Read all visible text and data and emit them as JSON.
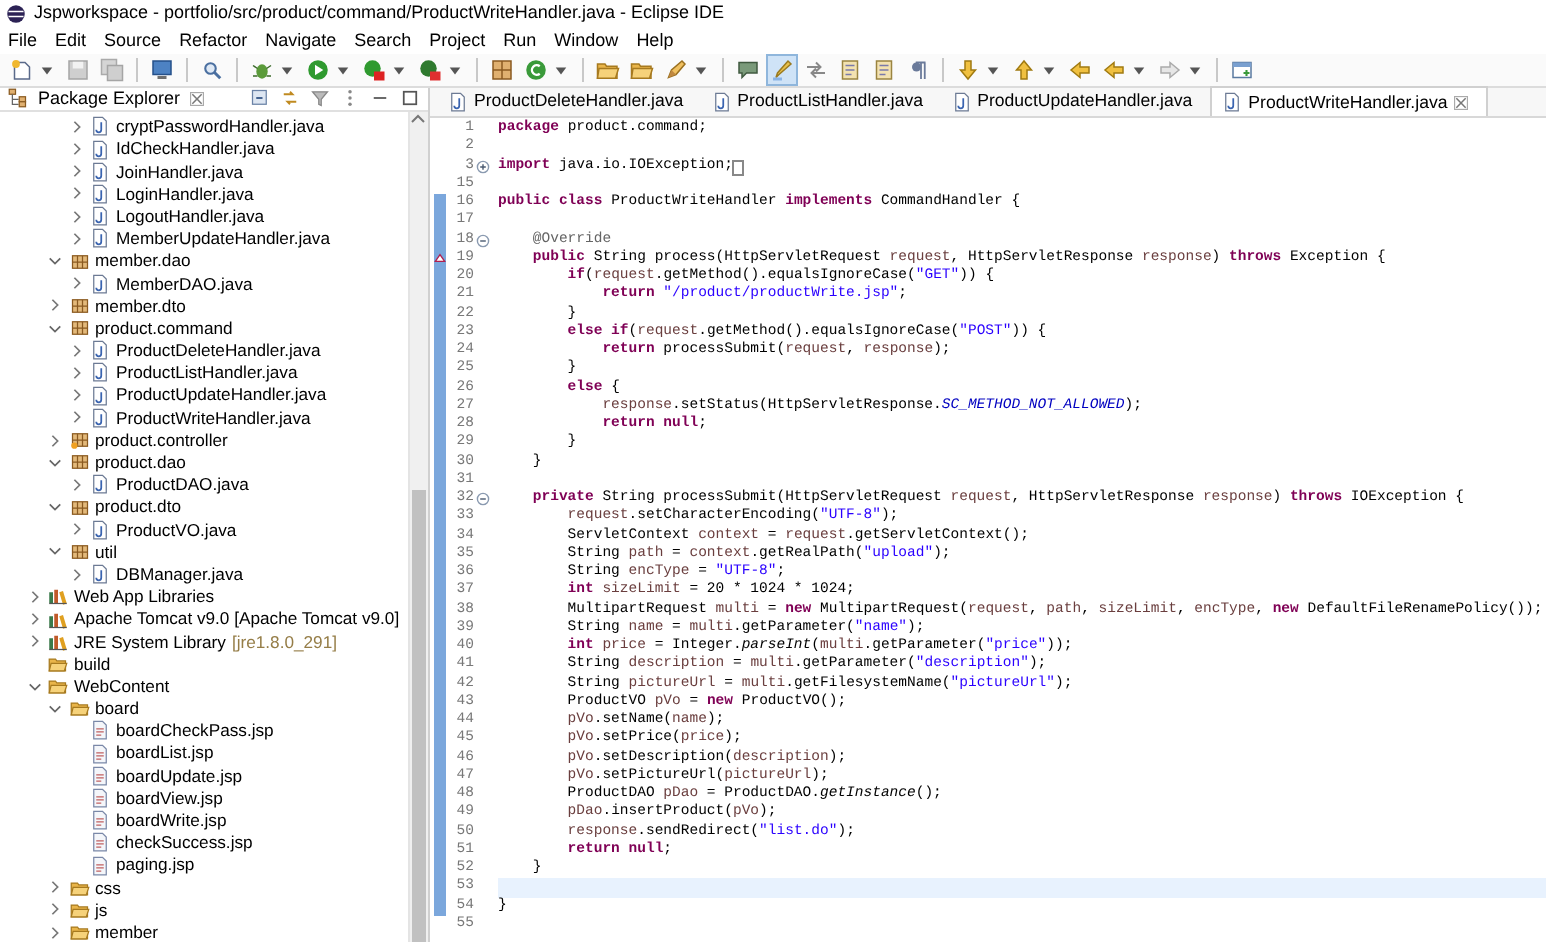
{
  "window": {
    "title": "Jspworkspace - portfolio/src/product/command/ProductWriteHandler.java - Eclipse IDE"
  },
  "menu": [
    "File",
    "Edit",
    "Source",
    "Refactor",
    "Navigate",
    "Search",
    "Project",
    "Run",
    "Window",
    "Help"
  ],
  "toolbar": [
    {
      "kind": "new",
      "dropdown": true,
      "pressed": false
    },
    {
      "kind": "save",
      "dropdown": false,
      "pressed": false
    },
    {
      "kind": "save-all",
      "dropdown": false,
      "pressed": false
    },
    {
      "kind": "separator"
    },
    {
      "kind": "monitor",
      "dropdown": false,
      "pressed": false
    },
    {
      "kind": "separator"
    },
    {
      "kind": "search",
      "dropdown": false,
      "pressed": false
    },
    {
      "kind": "separator"
    },
    {
      "kind": "debug",
      "dropdown": true,
      "pressed": false
    },
    {
      "kind": "run",
      "dropdown": true,
      "pressed": false
    },
    {
      "kind": "coverage",
      "dropdown": true,
      "pressed": false
    },
    {
      "kind": "external",
      "dropdown": true,
      "pressed": false
    },
    {
      "kind": "separator"
    },
    {
      "kind": "package",
      "dropdown": false,
      "pressed": false
    },
    {
      "kind": "class",
      "dropdown": true,
      "pressed": false
    },
    {
      "kind": "separator"
    },
    {
      "kind": "folder",
      "dropdown": false,
      "pressed": false
    },
    {
      "kind": "folder",
      "dropdown": false,
      "pressed": false
    },
    {
      "kind": "pencil",
      "dropdown": true,
      "pressed": false
    },
    {
      "kind": "separator"
    },
    {
      "kind": "bubble",
      "dropdown": false,
      "pressed": false
    },
    {
      "kind": "highlight",
      "dropdown": false,
      "pressed": true
    },
    {
      "kind": "arrows",
      "dropdown": false,
      "pressed": false
    },
    {
      "kind": "document",
      "dropdown": false,
      "pressed": false
    },
    {
      "kind": "document",
      "dropdown": false,
      "pressed": false
    },
    {
      "kind": "pilcrow",
      "dropdown": false,
      "pressed": false
    },
    {
      "kind": "separator"
    },
    {
      "kind": "down",
      "dropdown": true,
      "pressed": false
    },
    {
      "kind": "up",
      "dropdown": true,
      "pressed": false
    },
    {
      "kind": "back",
      "dropdown": false,
      "pressed": false
    },
    {
      "kind": "back",
      "dropdown": true,
      "pressed": false
    },
    {
      "kind": "forward",
      "dropdown": true,
      "pressed": false
    },
    {
      "kind": "separator"
    },
    {
      "kind": "window",
      "dropdown": false,
      "pressed": false
    }
  ],
  "package_explorer": {
    "title": "Package Explorer",
    "tree": [
      {
        "children": [
          {
            "children": [
              {
                "label": "cryptPasswordHandler.java",
                "kind": "java",
                "expanded": false
              },
              {
                "label": "IdCheckHandler.java",
                "kind": "java",
                "expanded": false
              },
              {
                "label": "JoinHandler.java",
                "kind": "java",
                "expanded": false
              },
              {
                "label": "LoginHandler.java",
                "kind": "java",
                "expanded": false
              },
              {
                "label": "LogoutHandler.java",
                "kind": "java",
                "expanded": false
              },
              {
                "label": "MemberUpdateHandler.java",
                "kind": "java",
                "expanded": false
              }
            ]
          },
          {
            "label": "member.dao",
            "kind": "package",
            "expanded": true,
            "children": [
              {
                "label": "MemberDAO.java",
                "kind": "java",
                "expanded": false
              }
            ]
          },
          {
            "label": "member.dto",
            "kind": "package",
            "expanded": false
          },
          {
            "label": "product.command",
            "kind": "package",
            "expanded": true,
            "children": [
              {
                "label": "ProductDeleteHandler.java",
                "kind": "java",
                "expanded": false
              },
              {
                "label": "ProductListHandler.java",
                "kind": "java",
                "expanded": false
              },
              {
                "label": "ProductUpdateHandler.java",
                "kind": "java",
                "expanded": false
              },
              {
                "label": "ProductWriteHandler.java",
                "kind": "java",
                "expanded": false
              }
            ]
          },
          {
            "label": "product.controller",
            "kind": "package-marked",
            "expanded": false
          },
          {
            "label": "product.dao",
            "kind": "package",
            "expanded": true,
            "children": [
              {
                "label": "ProductDAO.java",
                "kind": "java",
                "expanded": false
              }
            ]
          },
          {
            "label": "product.dto",
            "kind": "package",
            "expanded": true,
            "children": [
              {
                "label": "ProductVO.java",
                "kind": "java",
                "expanded": false
              }
            ]
          },
          {
            "label": "util",
            "kind": "package",
            "expanded": true,
            "children": [
              {
                "label": "DBManager.java",
                "kind": "java",
                "expanded": false
              }
            ]
          }
        ]
      },
      {
        "label": "Web App Libraries",
        "kind": "library",
        "expanded": false
      },
      {
        "label": "Apache Tomcat v9.0 [Apache Tomcat v9.0]",
        "kind": "library",
        "expanded": false
      },
      {
        "label": "JRE System Library",
        "decoration": "[jre1.8.0_291]",
        "kind": "library",
        "expanded": false
      },
      {
        "label": "build",
        "kind": "folder"
      },
      {
        "label": "WebContent",
        "kind": "folder",
        "expanded": true,
        "children": [
          {
            "label": "board",
            "kind": "folder",
            "expanded": true,
            "children": [
              {
                "label": "boardCheckPass.jsp",
                "kind": "jsp"
              },
              {
                "label": "boardList.jsp",
                "kind": "jsp"
              },
              {
                "label": "boardUpdate.jsp",
                "kind": "jsp"
              },
              {
                "label": "boardView.jsp",
                "kind": "jsp"
              },
              {
                "label": "boardWrite.jsp",
                "kind": "jsp"
              },
              {
                "label": "checkSuccess.jsp",
                "kind": "jsp"
              },
              {
                "label": "paging.jsp",
                "kind": "jsp"
              }
            ]
          },
          {
            "label": "css",
            "kind": "folder",
            "expanded": false
          },
          {
            "label": "js",
            "kind": "folder",
            "expanded": false
          },
          {
            "label": "member",
            "kind": "folder",
            "expanded": false
          }
        ]
      }
    ]
  },
  "editor": {
    "tabs": [
      {
        "label": "ProductDeleteHandler.java",
        "selected": false
      },
      {
        "label": "ProductListHandler.java",
        "selected": false
      },
      {
        "label": "ProductUpdateHandler.java",
        "selected": false
      },
      {
        "label": "ProductWriteHandler.java",
        "selected": true
      }
    ],
    "lines": [
      {
        "number": "1",
        "changed": false,
        "current": false,
        "tokens": [
          {
            "kind": "kw",
            "text": "package"
          },
          {
            "kind": "plain",
            "text": " product.command;"
          }
        ]
      },
      {
        "number": "2",
        "changed": false,
        "current": false
      },
      {
        "number": "3",
        "changed": false,
        "current": false,
        "collapsed": true,
        "tokens": [
          {
            "kind": "kw",
            "text": "import"
          },
          {
            "kind": "plain",
            "text": " java.io.IOException;"
          }
        ]
      },
      {
        "number": "15",
        "changed": false,
        "current": false
      },
      {
        "number": "16",
        "changed": true,
        "current": false,
        "tokens": [
          {
            "kind": "kw",
            "text": "public class"
          },
          {
            "kind": "plain",
            "text": " ProductWriteHandler "
          },
          {
            "kind": "kw",
            "text": "implements"
          },
          {
            "kind": "plain",
            "text": " CommandHandler {"
          }
        ]
      },
      {
        "number": "17",
        "changed": true,
        "current": false
      },
      {
        "number": "18",
        "changed": true,
        "current": false,
        "collapsed": false,
        "tokens": [
          {
            "kind": "ann",
            "text": "    @Override"
          }
        ]
      },
      {
        "number": "19",
        "changed": true,
        "current": false,
        "override": true,
        "tokens": [
          {
            "kind": "kw",
            "text": "    public"
          },
          {
            "kind": "plain",
            "text": " String process(HttpServletRequest "
          },
          {
            "kind": "var",
            "text": "request"
          },
          {
            "kind": "plain",
            "text": ", HttpServletResponse "
          },
          {
            "kind": "var",
            "text": "response"
          },
          {
            "kind": "plain",
            "text": ") "
          },
          {
            "kind": "kw",
            "text": "throws"
          },
          {
            "kind": "plain",
            "text": " Exception {"
          }
        ]
      },
      {
        "number": "20",
        "changed": true,
        "current": false,
        "tokens": [
          {
            "kind": "kw",
            "text": "        if"
          },
          {
            "kind": "plain",
            "text": "("
          },
          {
            "kind": "var",
            "text": "request"
          },
          {
            "kind": "plain",
            "text": ".getMethod().equalsIgnoreCase("
          },
          {
            "kind": "str",
            "text": "\"GET\""
          },
          {
            "kind": "plain",
            "text": ")) {"
          }
        ]
      },
      {
        "number": "21",
        "changed": true,
        "current": false,
        "tokens": [
          {
            "kind": "kw",
            "text": "            return"
          },
          {
            "kind": "str",
            "text": " \"/product/productWrite.jsp\""
          },
          {
            "kind": "plain",
            "text": ";"
          }
        ]
      },
      {
        "number": "22",
        "changed": true,
        "current": false,
        "tokens": [
          {
            "kind": "plain",
            "text": "        }"
          }
        ]
      },
      {
        "number": "23",
        "changed": true,
        "current": false,
        "tokens": [
          {
            "kind": "kw",
            "text": "        else if"
          },
          {
            "kind": "plain",
            "text": "("
          },
          {
            "kind": "var",
            "text": "request"
          },
          {
            "kind": "plain",
            "text": ".getMethod().equalsIgnoreCase("
          },
          {
            "kind": "str",
            "text": "\"POST\""
          },
          {
            "kind": "plain",
            "text": ")) {"
          }
        ]
      },
      {
        "number": "24",
        "changed": true,
        "current": false,
        "tokens": [
          {
            "kind": "kw",
            "text": "            return"
          },
          {
            "kind": "plain",
            "text": " processSubmit("
          },
          {
            "kind": "var",
            "text": "request"
          },
          {
            "kind": "plain",
            "text": ", "
          },
          {
            "kind": "var",
            "text": "response"
          },
          {
            "kind": "plain",
            "text": ");"
          }
        ]
      },
      {
        "number": "25",
        "changed": true,
        "current": false,
        "tokens": [
          {
            "kind": "plain",
            "text": "        }"
          }
        ]
      },
      {
        "number": "26",
        "changed": true,
        "current": false,
        "tokens": [
          {
            "kind": "kw",
            "text": "        else"
          },
          {
            "kind": "plain",
            "text": " {"
          }
        ]
      },
      {
        "number": "27",
        "changed": true,
        "current": false,
        "tokens": [
          {
            "kind": "var",
            "text": "            response"
          },
          {
            "kind": "plain",
            "text": ".setStatus(HttpServletResponse."
          },
          {
            "kind": "field",
            "text": "SC_METHOD_NOT_ALLOWED"
          },
          {
            "kind": "plain",
            "text": ");"
          }
        ]
      },
      {
        "number": "28",
        "changed": true,
        "current": false,
        "tokens": [
          {
            "kind": "kw",
            "text": "            return null"
          },
          {
            "kind": "plain",
            "text": ";"
          }
        ]
      },
      {
        "number": "29",
        "changed": true,
        "current": false,
        "tokens": [
          {
            "kind": "plain",
            "text": "        }"
          }
        ]
      },
      {
        "number": "30",
        "changed": true,
        "current": false,
        "tokens": [
          {
            "kind": "plain",
            "text": "    }"
          }
        ]
      },
      {
        "number": "31",
        "changed": true,
        "current": false
      },
      {
        "number": "32",
        "changed": true,
        "current": false,
        "collapsed": false,
        "tokens": [
          {
            "kind": "kw",
            "text": "    private"
          },
          {
            "kind": "plain",
            "text": " String processSubmit(HttpServletRequest "
          },
          {
            "kind": "var",
            "text": "request"
          },
          {
            "kind": "plain",
            "text": ", HttpServletResponse "
          },
          {
            "kind": "var",
            "text": "response"
          },
          {
            "kind": "plain",
            "text": ") "
          },
          {
            "kind": "kw",
            "text": "throws"
          },
          {
            "kind": "plain",
            "text": " IOException {"
          }
        ]
      },
      {
        "number": "33",
        "changed": true,
        "current": false,
        "tokens": [
          {
            "kind": "var",
            "text": "        request"
          },
          {
            "kind": "plain",
            "text": ".setCharacterEncoding("
          },
          {
            "kind": "str",
            "text": "\"UTF-8\""
          },
          {
            "kind": "plain",
            "text": ");"
          }
        ]
      },
      {
        "number": "34",
        "changed": true,
        "current": false,
        "tokens": [
          {
            "kind": "plain",
            "text": "        ServletContext "
          },
          {
            "kind": "var",
            "text": "context"
          },
          {
            "kind": "plain",
            "text": " = "
          },
          {
            "kind": "var",
            "text": "request"
          },
          {
            "kind": "plain",
            "text": ".getServletContext();"
          }
        ]
      },
      {
        "number": "35",
        "changed": true,
        "current": false,
        "tokens": [
          {
            "kind": "plain",
            "text": "        String "
          },
          {
            "kind": "var",
            "text": "path"
          },
          {
            "kind": "plain",
            "text": " = "
          },
          {
            "kind": "var",
            "text": "context"
          },
          {
            "kind": "plain",
            "text": ".getRealPath("
          },
          {
            "kind": "str",
            "text": "\"upload\""
          },
          {
            "kind": "plain",
            "text": ");"
          }
        ]
      },
      {
        "number": "36",
        "changed": true,
        "current": false,
        "tokens": [
          {
            "kind": "plain",
            "text": "        String "
          },
          {
            "kind": "var",
            "text": "encType"
          },
          {
            "kind": "plain",
            "text": " = "
          },
          {
            "kind": "str",
            "text": "\"UTF-8\""
          },
          {
            "kind": "plain",
            "text": ";"
          }
        ]
      },
      {
        "number": "37",
        "changed": true,
        "current": false,
        "tokens": [
          {
            "kind": "kw",
            "text": "        int"
          },
          {
            "kind": "var",
            "text": " sizeLimit"
          },
          {
            "kind": "plain",
            "text": " = 20 * 1024 * 1024;"
          }
        ]
      },
      {
        "number": "38",
        "changed": true,
        "current": false,
        "tokens": [
          {
            "kind": "plain",
            "text": "        MultipartRequest "
          },
          {
            "kind": "var",
            "text": "multi"
          },
          {
            "kind": "plain",
            "text": " = "
          },
          {
            "kind": "kw",
            "text": "new"
          },
          {
            "kind": "plain",
            "text": " MultipartRequest("
          },
          {
            "kind": "var",
            "text": "request"
          },
          {
            "kind": "plain",
            "text": ", "
          },
          {
            "kind": "var",
            "text": "path"
          },
          {
            "kind": "plain",
            "text": ", "
          },
          {
            "kind": "var",
            "text": "sizeLimit"
          },
          {
            "kind": "plain",
            "text": ", "
          },
          {
            "kind": "var",
            "text": "encType"
          },
          {
            "kind": "plain",
            "text": ", "
          },
          {
            "kind": "kw",
            "text": "new"
          },
          {
            "kind": "plain",
            "text": " DefaultFileRenamePolicy());"
          }
        ]
      },
      {
        "number": "39",
        "changed": true,
        "current": false,
        "tokens": [
          {
            "kind": "plain",
            "text": "        String "
          },
          {
            "kind": "var",
            "text": "name"
          },
          {
            "kind": "plain",
            "text": " = "
          },
          {
            "kind": "var",
            "text": "multi"
          },
          {
            "kind": "plain",
            "text": ".getParameter("
          },
          {
            "kind": "str",
            "text": "\"name\""
          },
          {
            "kind": "plain",
            "text": ");"
          }
        ]
      },
      {
        "number": "40",
        "changed": true,
        "current": false,
        "tokens": [
          {
            "kind": "kw",
            "text": "        int"
          },
          {
            "kind": "var",
            "text": " price"
          },
          {
            "kind": "plain",
            "text": " = Integer."
          },
          {
            "kind": "static",
            "text": "parseInt"
          },
          {
            "kind": "plain",
            "text": "("
          },
          {
            "kind": "var",
            "text": "multi"
          },
          {
            "kind": "plain",
            "text": ".getParameter("
          },
          {
            "kind": "str",
            "text": "\"price\""
          },
          {
            "kind": "plain",
            "text": "));"
          }
        ]
      },
      {
        "number": "41",
        "changed": true,
        "current": false,
        "tokens": [
          {
            "kind": "plain",
            "text": "        String "
          },
          {
            "kind": "var",
            "text": "description"
          },
          {
            "kind": "plain",
            "text": " = "
          },
          {
            "kind": "var",
            "text": "multi"
          },
          {
            "kind": "plain",
            "text": ".getParameter("
          },
          {
            "kind": "str",
            "text": "\"description\""
          },
          {
            "kind": "plain",
            "text": ");"
          }
        ]
      },
      {
        "number": "42",
        "changed": true,
        "current": false,
        "tokens": [
          {
            "kind": "plain",
            "text": "        String "
          },
          {
            "kind": "var",
            "text": "pictureUrl"
          },
          {
            "kind": "plain",
            "text": " = "
          },
          {
            "kind": "var",
            "text": "multi"
          },
          {
            "kind": "plain",
            "text": ".getFilesystemName("
          },
          {
            "kind": "str",
            "text": "\"pictureUrl\""
          },
          {
            "kind": "plain",
            "text": ");"
          }
        ]
      },
      {
        "number": "43",
        "changed": true,
        "current": false,
        "tokens": [
          {
            "kind": "plain",
            "text": "        ProductVO "
          },
          {
            "kind": "var",
            "text": "pVo"
          },
          {
            "kind": "plain",
            "text": " = "
          },
          {
            "kind": "kw",
            "text": "new"
          },
          {
            "kind": "plain",
            "text": " ProductVO();"
          }
        ]
      },
      {
        "number": "44",
        "changed": true,
        "current": false,
        "tokens": [
          {
            "kind": "var",
            "text": "        pVo"
          },
          {
            "kind": "plain",
            "text": ".setName("
          },
          {
            "kind": "var",
            "text": "name"
          },
          {
            "kind": "plain",
            "text": ");"
          }
        ]
      },
      {
        "number": "45",
        "changed": true,
        "current": false,
        "tokens": [
          {
            "kind": "var",
            "text": "        pVo"
          },
          {
            "kind": "plain",
            "text": ".setPrice("
          },
          {
            "kind": "var",
            "text": "price"
          },
          {
            "kind": "plain",
            "text": ");"
          }
        ]
      },
      {
        "number": "46",
        "changed": true,
        "current": false,
        "tokens": [
          {
            "kind": "var",
            "text": "        pVo"
          },
          {
            "kind": "plain",
            "text": ".setDescription("
          },
          {
            "kind": "var",
            "text": "description"
          },
          {
            "kind": "plain",
            "text": ");"
          }
        ]
      },
      {
        "number": "47",
        "changed": true,
        "current": false,
        "tokens": [
          {
            "kind": "var",
            "text": "        pVo"
          },
          {
            "kind": "plain",
            "text": ".setPictureUrl("
          },
          {
            "kind": "var",
            "text": "pictureUrl"
          },
          {
            "kind": "plain",
            "text": ");"
          }
        ]
      },
      {
        "number": "48",
        "changed": true,
        "current": false,
        "tokens": [
          {
            "kind": "plain",
            "text": "        ProductDAO "
          },
          {
            "kind": "var",
            "text": "pDao"
          },
          {
            "kind": "plain",
            "text": " = ProductDAO."
          },
          {
            "kind": "static",
            "text": "getInstance"
          },
          {
            "kind": "plain",
            "text": "();"
          }
        ]
      },
      {
        "number": "49",
        "changed": true,
        "current": false,
        "tokens": [
          {
            "kind": "var",
            "text": "        pDao"
          },
          {
            "kind": "plain",
            "text": ".insertProduct("
          },
          {
            "kind": "var",
            "text": "pVo"
          },
          {
            "kind": "plain",
            "text": ");"
          }
        ]
      },
      {
        "number": "50",
        "changed": true,
        "current": false,
        "tokens": [
          {
            "kind": "var",
            "text": "        response"
          },
          {
            "kind": "plain",
            "text": ".sendRedirect("
          },
          {
            "kind": "str",
            "text": "\"list.do\""
          },
          {
            "kind": "plain",
            "text": ");"
          }
        ]
      },
      {
        "number": "51",
        "changed": true,
        "current": false,
        "tokens": [
          {
            "kind": "kw",
            "text": "        return null"
          },
          {
            "kind": "plain",
            "text": ";"
          }
        ]
      },
      {
        "number": "52",
        "changed": true,
        "current": false,
        "tokens": [
          {
            "kind": "plain",
            "text": "    }"
          }
        ]
      },
      {
        "number": "53",
        "changed": true,
        "current": true
      },
      {
        "number": "54",
        "changed": true,
        "current": false,
        "tokens": [
          {
            "kind": "plain",
            "text": "}"
          }
        ]
      },
      {
        "number": "55",
        "changed": false,
        "current": false
      }
    ]
  }
}
